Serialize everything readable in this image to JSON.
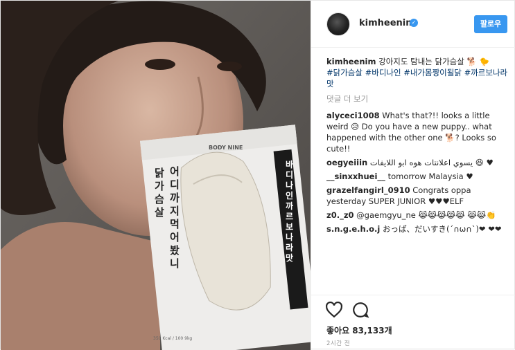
{
  "photo": {
    "card_brand": "BODY NINE",
    "card_left_text": "닭가슴살",
    "card_mid_text": "어디까지먹어봤니",
    "card_right_text": "바디나인 까르보나라맛",
    "card_footer": "350 Kcal / 100 9kg"
  },
  "header": {
    "username": "kimheenim",
    "follow_label": "팔로우"
  },
  "caption": {
    "username": "kimheenim",
    "text": "강아지도 탐내는 닭가슴살",
    "tags": "#닭가슴살 #바디나인 #내가몸짱이될닭 #까르보나라맛"
  },
  "more_comments": "댓글 더 보기",
  "comments": [
    {
      "user": "alyceci1008",
      "text": "What's that?!! looks a little weird 😥 Do you have a new puppy.. what happened with the other one 🐕? Looks so cute!!"
    },
    {
      "user": "oegyeiiin",
      "text": "يسوي اعلانتات هوه ابو اللايفات 😆 ♥"
    },
    {
      "user": "__sinxxhuei__",
      "text": "tomorrow Malaysia ♥"
    },
    {
      "user": "grazelfangirl_0910",
      "text": "Congrats oppa yesterday SUPER JUNIOR ♥♥♥ELF"
    },
    {
      "user": "z0._z0",
      "text": "@gaemgyu_ne 😹😹😹😹😹 😹😹👏"
    },
    {
      "user": "s.n.g.e.h.o.j",
      "text": "おっぱ、だいすき(´∩ω∩`)❤ ❤❤"
    }
  ],
  "likes": "좋아요 83,133개",
  "timestamp": "2시간 전",
  "colors": {
    "accent": "#3897f0",
    "border": "#efefef",
    "muted": "#999999",
    "tag": "#003569"
  }
}
